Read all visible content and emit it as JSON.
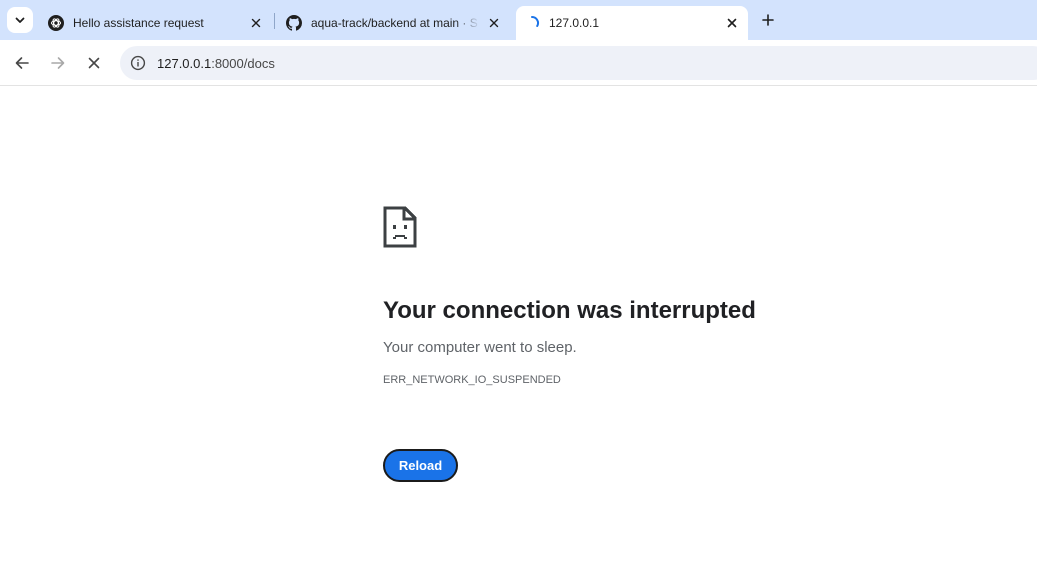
{
  "browser": {
    "tabs": [
      {
        "title": "Hello assistance request",
        "favicon": "openai-logo-icon",
        "active": false
      },
      {
        "title": "aqua-track/backend at main · S",
        "favicon": "github-logo-icon",
        "active": false
      },
      {
        "title": "127.0.0.1",
        "favicon": "loading-spinner-icon",
        "active": true
      }
    ],
    "address_bar": {
      "host": "127.0.0.1",
      "path": ":8000/docs"
    },
    "icons": {
      "tab_search": "chevron-down-icon",
      "new_tab": "plus-icon",
      "back": "arrow-left-icon",
      "forward": "arrow-right-icon",
      "stop": "close-icon",
      "site_info": "info-icon"
    }
  },
  "error_page": {
    "icon": "sad-page-icon",
    "heading": "Your connection was interrupted",
    "message": "Your computer went to sleep.",
    "error_code": "ERR_NETWORK_IO_SUSPENDED",
    "reload_label": "Reload"
  },
  "colors": {
    "tabstrip_bg": "#d3e3fd",
    "reload_button": "#1a73e8",
    "heading": "#202124",
    "secondary_text": "#5f6368"
  }
}
